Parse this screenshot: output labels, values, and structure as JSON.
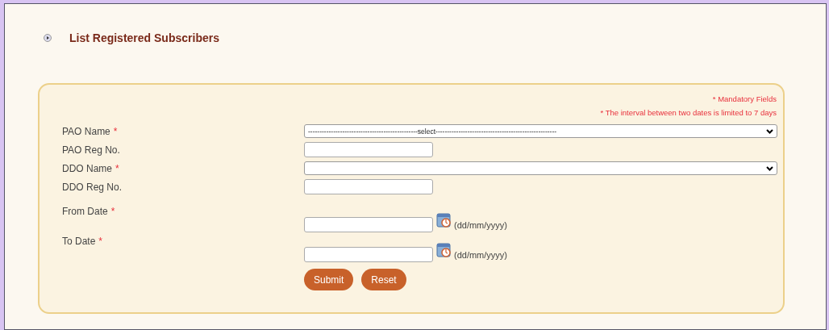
{
  "title": "List Registered Subscribers",
  "notes": [
    "* Mandatory Fields",
    "* The interval between two dates is limited to 7 days"
  ],
  "fields": [
    {
      "kind": "select",
      "label": "PAO Name",
      "mark": "*",
      "value": "------------------------------------------------select-----------------------------------------------------"
    },
    {
      "kind": "text",
      "label": "PAO Reg No."
    },
    {
      "kind": "select",
      "label": "DDO Name",
      "mark": "*"
    },
    {
      "kind": "text",
      "label": "DDO Reg No."
    },
    {
      "kind": "date",
      "label": "From Date",
      "mark": "*",
      "hint": "(dd/mm/yyyy)"
    },
    {
      "kind": "date",
      "label": "To Date",
      "mark": "*",
      "hint": "(dd/mm/yyyy)"
    }
  ],
  "buttons": [
    "Submit",
    "Reset"
  ]
}
